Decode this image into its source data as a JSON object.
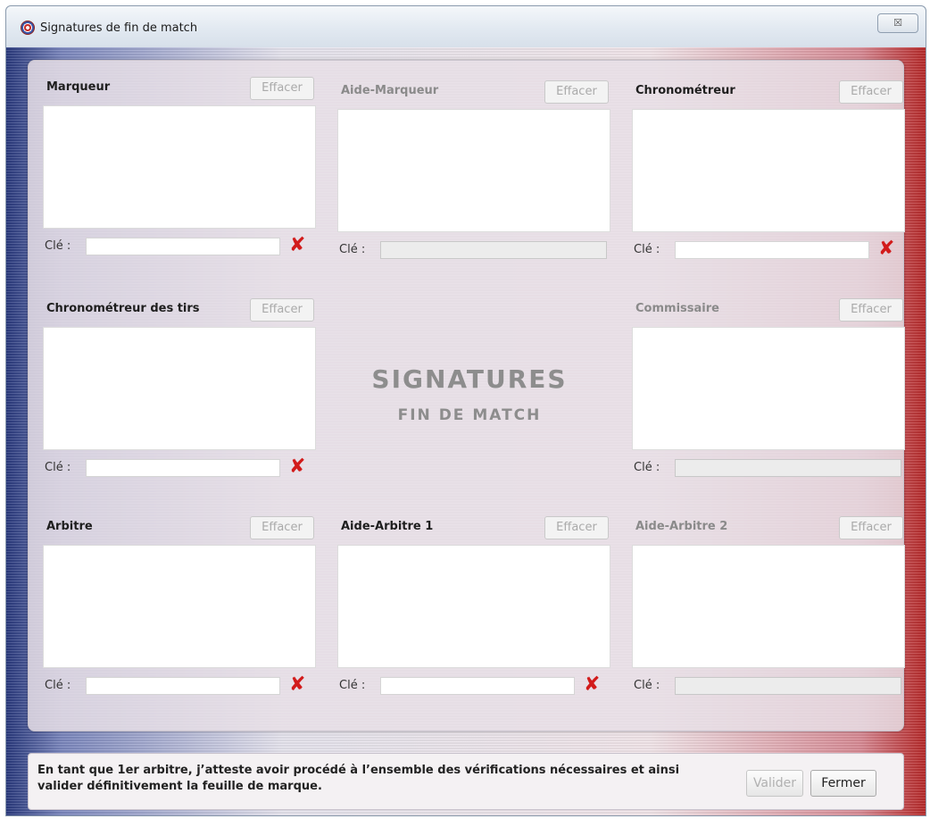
{
  "window": {
    "title": "Signatures de fin de match",
    "close_glyph": "☒"
  },
  "cells": [
    {
      "title": "Marqueur",
      "effacer": "Effacer",
      "cle": "Clé :",
      "x_mark": "✘"
    },
    {
      "title": "Aide-Marqueur",
      "effacer": "Effacer",
      "cle": "Clé :"
    },
    {
      "title": "Chronométreur",
      "effacer": "Effacer",
      "cle": "Clé :",
      "x_mark": "✘"
    },
    {
      "title": "Chronométreur des tirs",
      "effacer": "Effacer",
      "cle": "Clé :",
      "x_mark": "✘"
    },
    {
      "title": "Commissaire",
      "effacer": "Effacer",
      "cle": "Clé :"
    },
    {
      "title": "Arbitre",
      "effacer": "Effacer",
      "cle": "Clé :",
      "x_mark": "✘"
    },
    {
      "title": "Aide-Arbitre 1",
      "effacer": "Effacer",
      "cle": "Clé :",
      "x_mark": "✘"
    },
    {
      "title": "Aide-Arbitre 2",
      "effacer": "Effacer",
      "cle": "Clé :"
    }
  ],
  "center": {
    "line1": "SIGNATURES",
    "line2": "FIN DE MATCH"
  },
  "footer": {
    "text": "En tant que 1er arbitre, j’atteste avoir procédé à l’ensemble des vérifications nécessaires et ainsi valider définitivement la feuille de marque.",
    "valider": "Valider",
    "fermer": "Fermer"
  },
  "colors": {
    "accent_red": "#d21b1b",
    "flag_blue": "#2a3a7e",
    "flag_red": "#b82a2a"
  }
}
